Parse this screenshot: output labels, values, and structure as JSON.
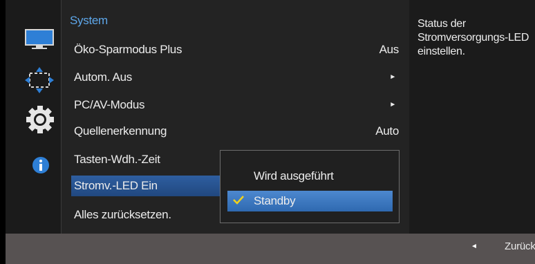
{
  "colors": {
    "accent": "#5ea7ea",
    "selection": "#2e5ea0",
    "check": "#f0d21c"
  },
  "sidebar": {
    "icons": [
      "monitor-icon",
      "arrows-icon",
      "gear-icon",
      "info-icon"
    ]
  },
  "menu": {
    "title": "System",
    "items": [
      {
        "label": "Öko-Sparmodus Plus",
        "value": "Aus"
      },
      {
        "label": "Autom. Aus",
        "value": "►"
      },
      {
        "label": "PC/AV-Modus",
        "value": "►"
      },
      {
        "label": "Quellenerkennung",
        "value": "Auto"
      },
      {
        "label": "Tasten-Wdh.-Zeit",
        "value": ""
      },
      {
        "label": "Stromv.-LED Ein",
        "value": ""
      },
      {
        "label": "Alles zurücksetzen.",
        "value": ""
      }
    ],
    "selected_index": 5
  },
  "submenu": {
    "options": [
      "Wird ausgeführt",
      "Standby"
    ],
    "selected": "Standby"
  },
  "help": {
    "text": "Status der Stromversorgungs-LED einstellen."
  },
  "footer": {
    "back_label": "Zurück"
  }
}
